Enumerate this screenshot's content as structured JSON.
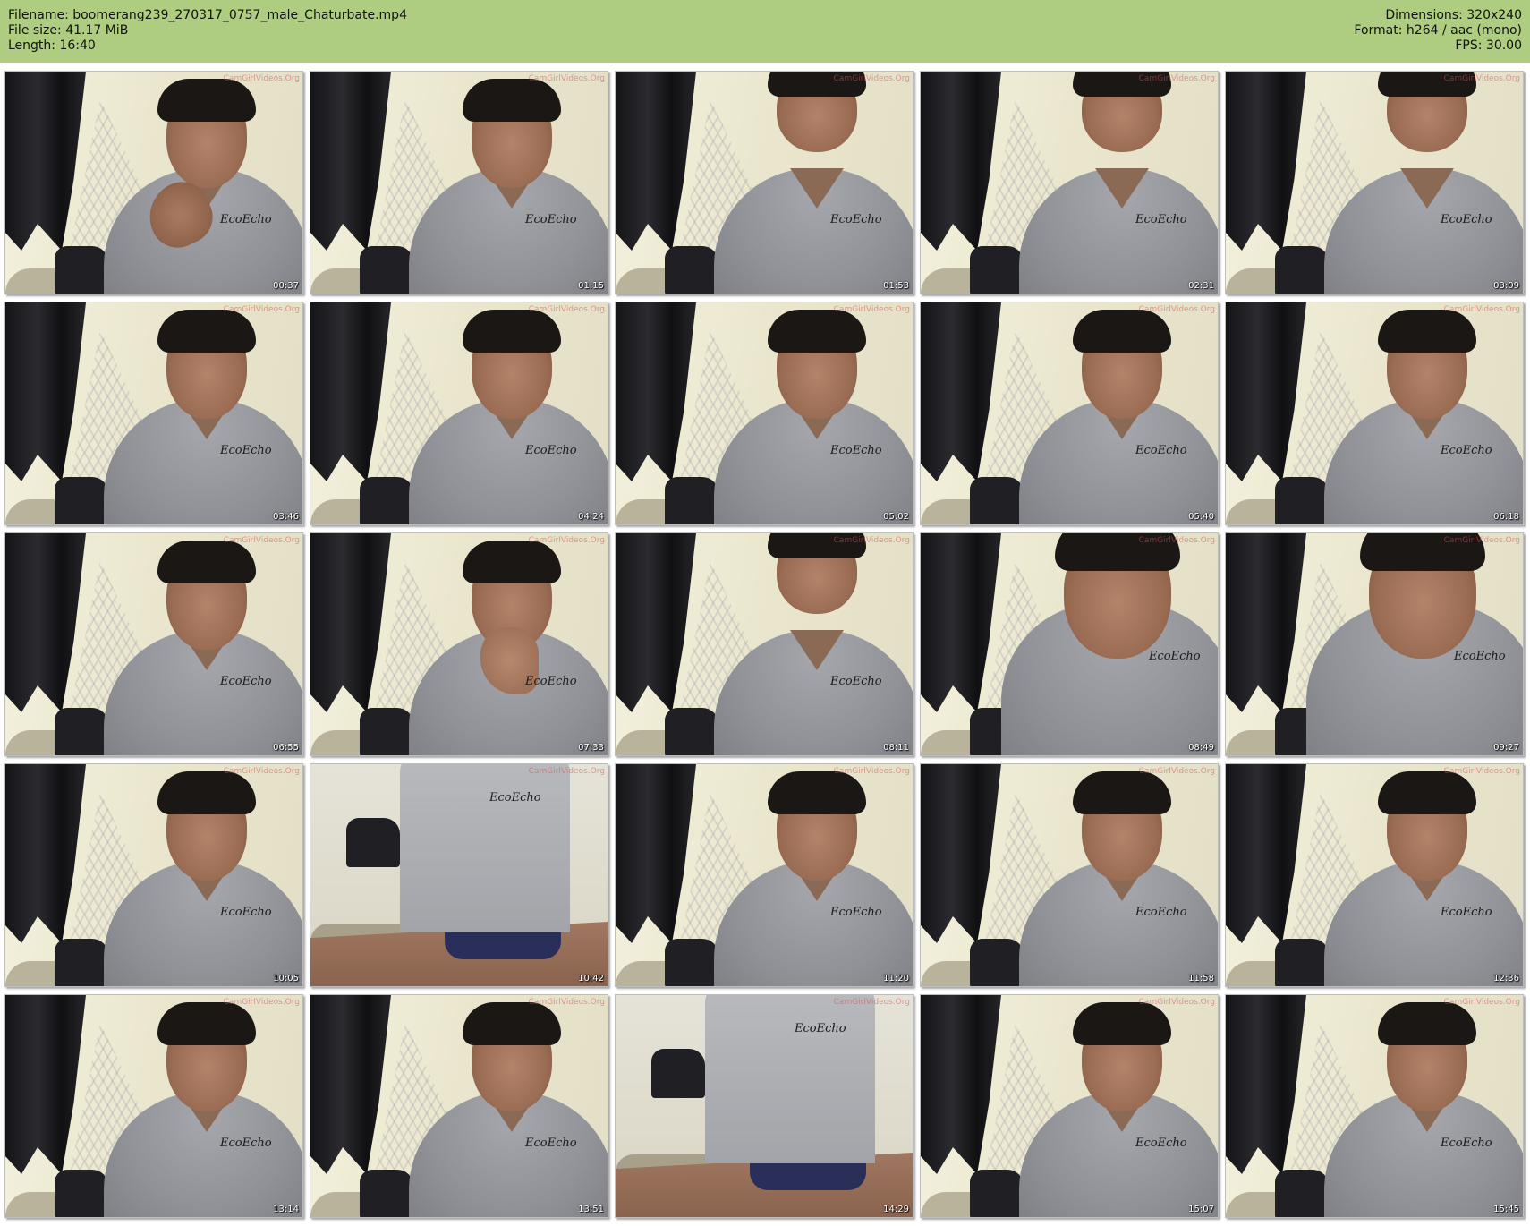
{
  "header": {
    "filename": "Filename: boomerang239_270317_0757_male_Chaturbate.mp4",
    "filesize": "File size: 41.17 MiB",
    "length": "Length: 16:40",
    "dimensions": "Dimensions: 320x240",
    "format": "Format: h264 / aac (mono)",
    "fps": "FPS: 30.00"
  },
  "colors": {
    "header_bg": "#afcd80",
    "page_bg": "#ffffff"
  },
  "thumbnails": [
    {
      "time": "00:37",
      "scene": "wave"
    },
    {
      "time": "01:15",
      "scene": "normal"
    },
    {
      "time": "01:53",
      "scene": "low"
    },
    {
      "time": "02:31",
      "scene": "low"
    },
    {
      "time": "03:09",
      "scene": "low"
    },
    {
      "time": "03:46",
      "scene": "normal"
    },
    {
      "time": "04:24",
      "scene": "normal"
    },
    {
      "time": "05:02",
      "scene": "normal"
    },
    {
      "time": "05:40",
      "scene": "normal"
    },
    {
      "time": "06:18",
      "scene": "normal"
    },
    {
      "time": "06:55",
      "scene": "normal"
    },
    {
      "time": "07:33",
      "scene": "hand"
    },
    {
      "time": "08:11",
      "scene": "low"
    },
    {
      "time": "08:49",
      "scene": "close"
    },
    {
      "time": "09:27",
      "scene": "close"
    },
    {
      "time": "10:05",
      "scene": "normal"
    },
    {
      "time": "10:42",
      "scene": "sit"
    },
    {
      "time": "11:20",
      "scene": "normal"
    },
    {
      "time": "11:58",
      "scene": "normal"
    },
    {
      "time": "12:36",
      "scene": "normal"
    },
    {
      "time": "13:14",
      "scene": "normal"
    },
    {
      "time": "13:51",
      "scene": "normal"
    },
    {
      "time": "14:29",
      "scene": "sit"
    },
    {
      "time": "15:07",
      "scene": "normal"
    },
    {
      "time": "15:45",
      "scene": "normal"
    }
  ],
  "watermark": "CamGirlVideos.Org",
  "shirt_logo": "EcoEcho"
}
